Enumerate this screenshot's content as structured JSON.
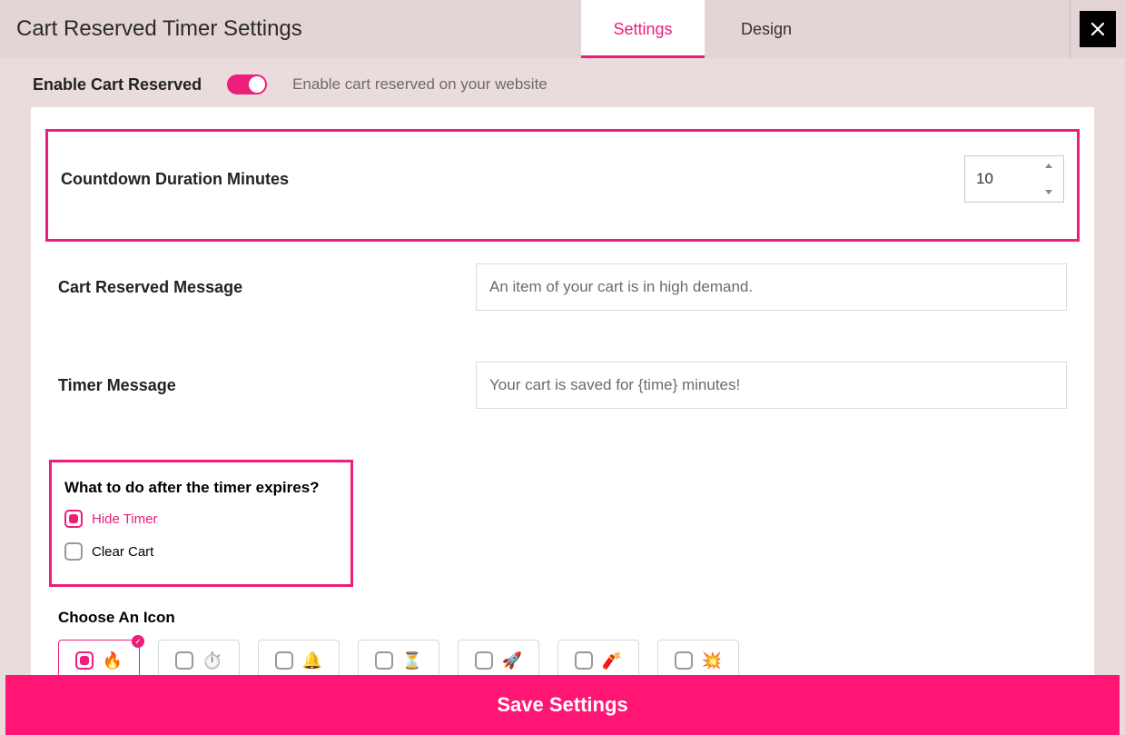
{
  "header": {
    "title": "Cart Reserved Timer Settings",
    "tabs": {
      "settings": "Settings",
      "design": "Design"
    }
  },
  "enable": {
    "label": "Enable Cart Reserved",
    "description": "Enable cart reserved on your website",
    "value": true
  },
  "countdown": {
    "label": "Countdown Duration Minutes",
    "value": "10"
  },
  "cart_message": {
    "label": "Cart Reserved Message",
    "placeholder": "An item of your cart is in high demand.",
    "value": ""
  },
  "timer_message": {
    "label": "Timer Message",
    "placeholder": "Your cart is saved for {time} minutes!",
    "value": ""
  },
  "expire": {
    "title": "What to do after the timer expires?",
    "options": {
      "hide": "Hide Timer",
      "clear": "Clear Cart"
    },
    "selected": "hide"
  },
  "icons": {
    "title": "Choose An Icon",
    "items": [
      "🔥",
      "⏱️",
      "🔔",
      "⏳",
      "🚀",
      "🧨",
      "💥"
    ],
    "selected_index": 0
  },
  "save_label": "Save Settings",
  "colors": {
    "accent": "#ed1e79",
    "save": "#ff1674"
  }
}
